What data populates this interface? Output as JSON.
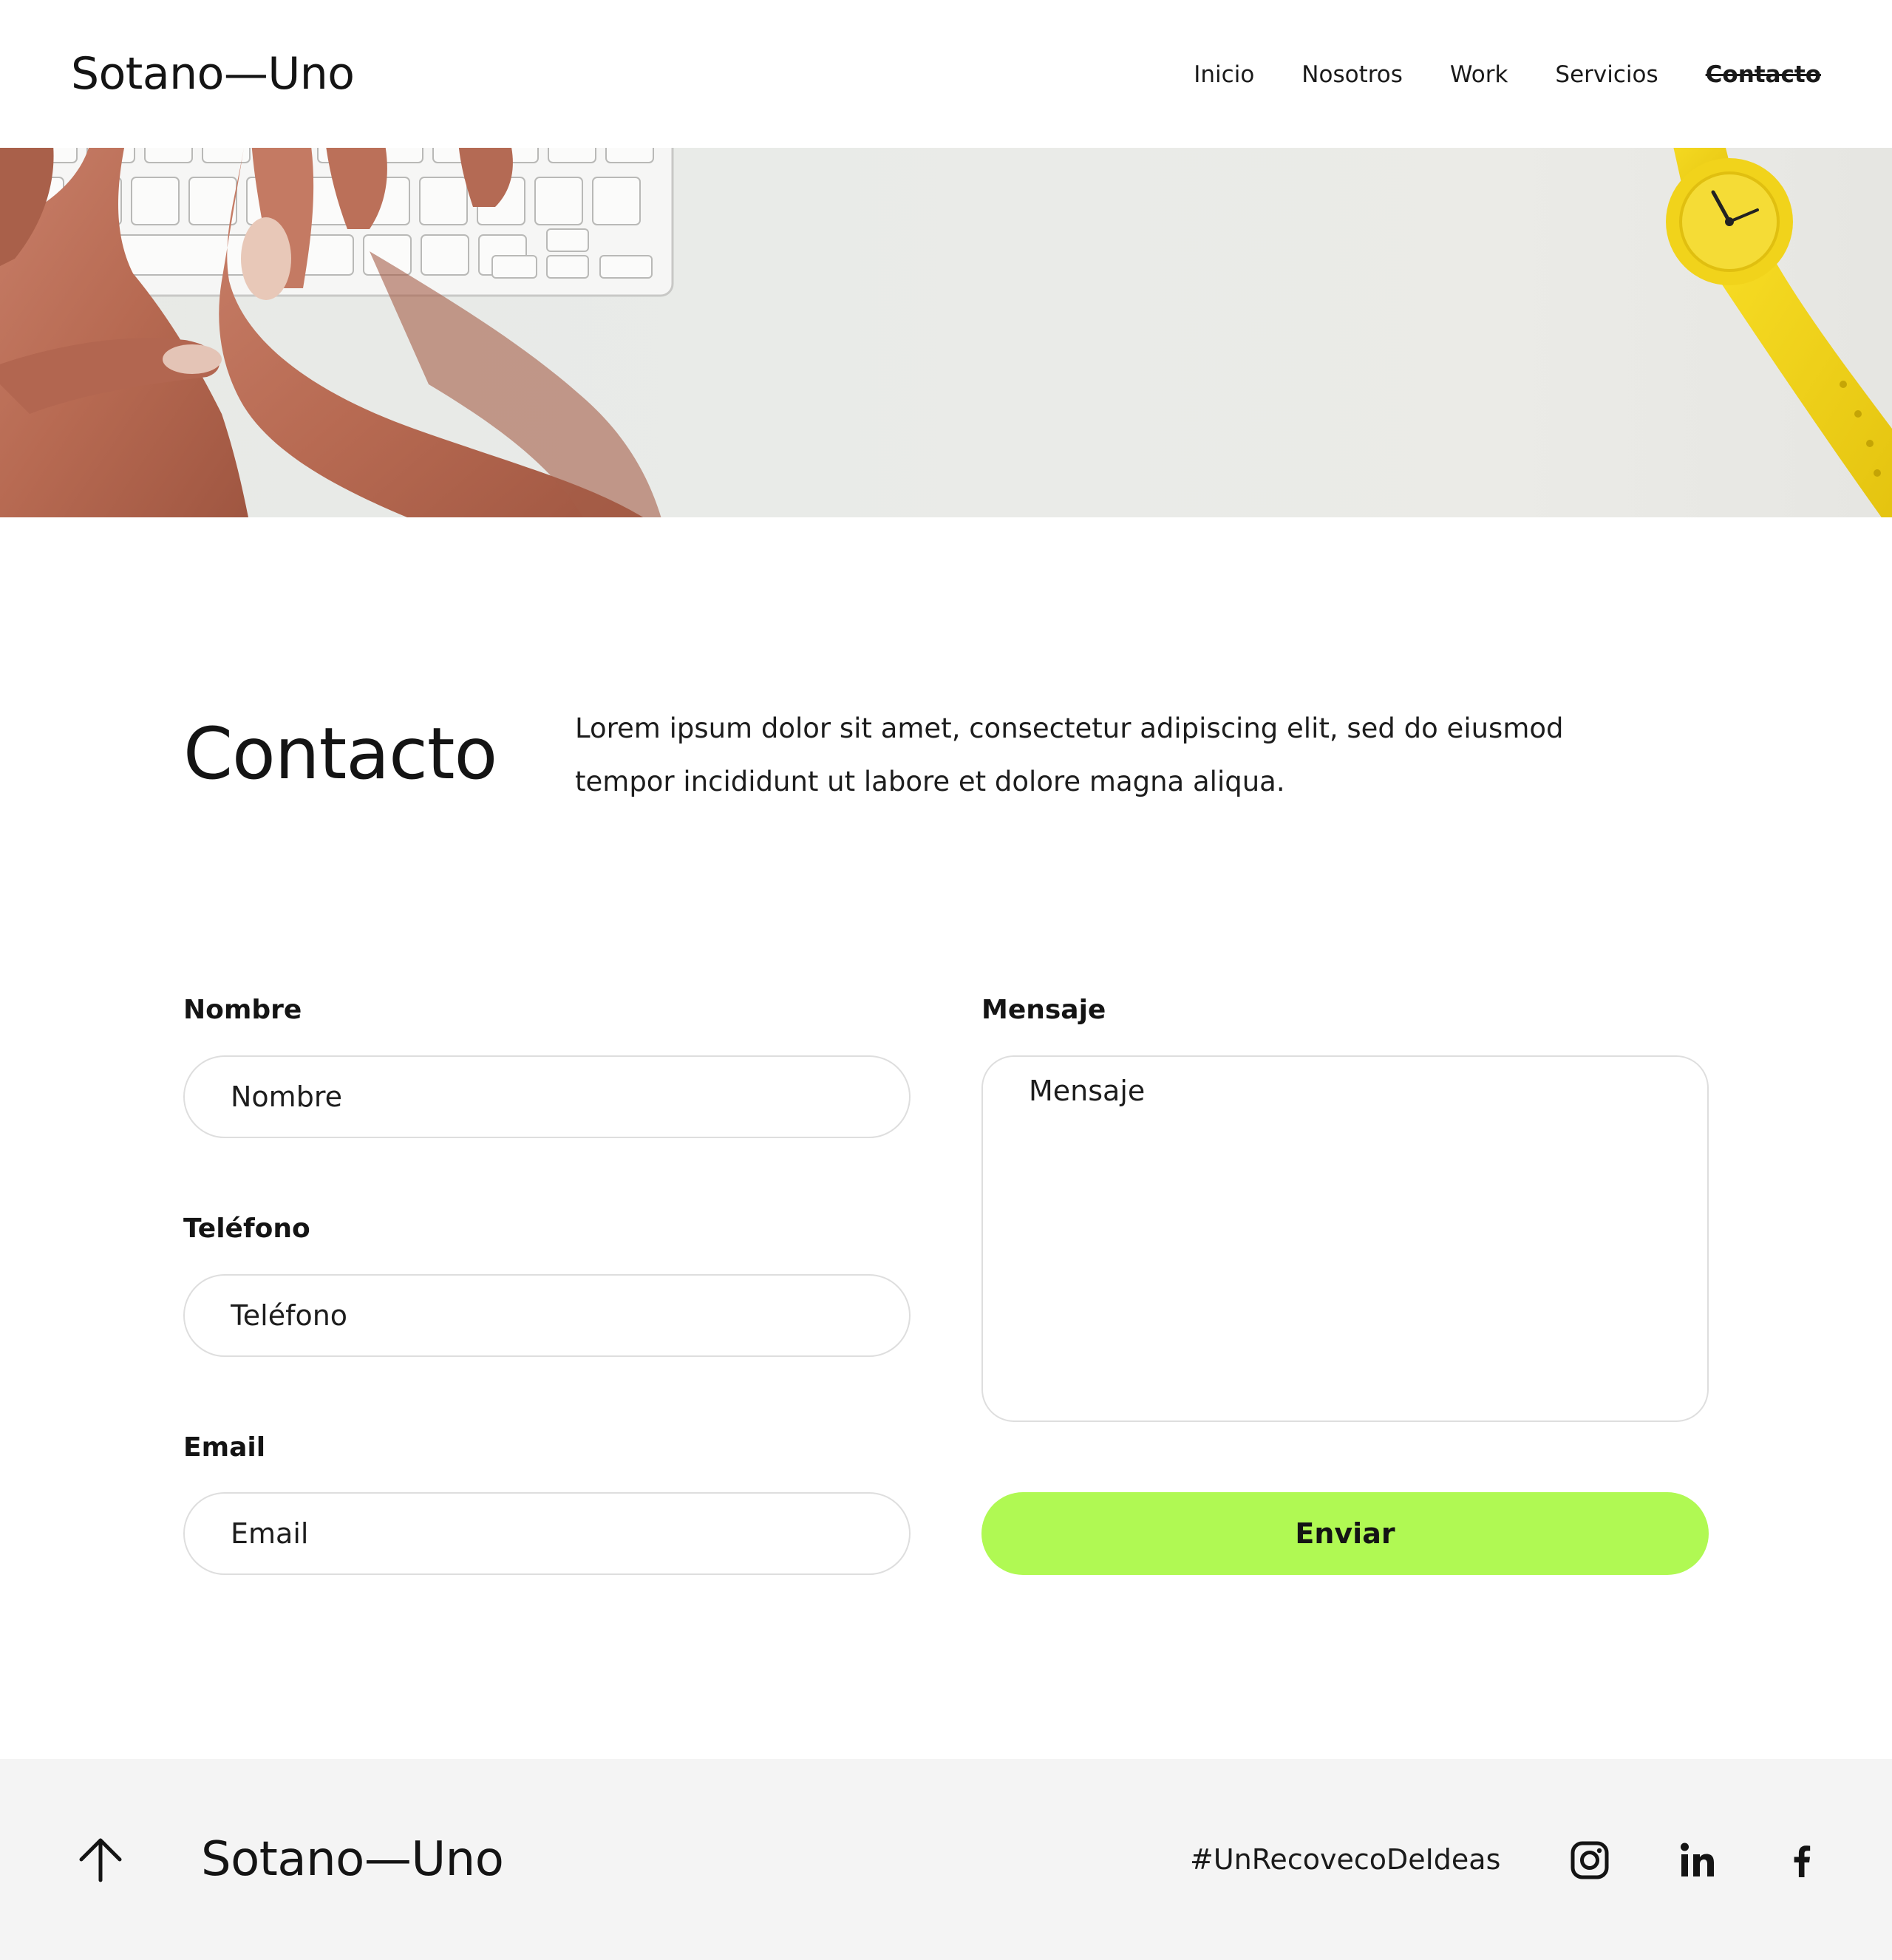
{
  "brand": {
    "name": "Sotano—Uno"
  },
  "nav": {
    "items": [
      {
        "label": "Inicio",
        "active": false
      },
      {
        "label": "Nosotros",
        "active": false
      },
      {
        "label": "Work",
        "active": false
      },
      {
        "label": "Servicios",
        "active": false
      },
      {
        "label": "Contacto",
        "active": true
      }
    ]
  },
  "hero": {
    "image": "hands-typing-keyboard-yellow-watch"
  },
  "contact": {
    "title": "Contacto",
    "intro": "Lorem ipsum dolor sit amet, consectetur adipiscing elit, sed do eiusmod tempor incididunt ut labore et dolore magna aliqua."
  },
  "form": {
    "name": {
      "label": "Nombre",
      "placeholder": "Nombre"
    },
    "phone": {
      "label": "Teléfono",
      "placeholder": "Teléfono"
    },
    "email": {
      "label": "Email",
      "placeholder": "Email"
    },
    "message": {
      "label": "Mensaje",
      "placeholder": "Mensaje"
    },
    "submit_label": "Enviar"
  },
  "footer": {
    "brand": "Sotano—Uno",
    "hashtag": "#UnRecovecoDeIdeas",
    "social": [
      "instagram-icon",
      "linkedin-icon",
      "facebook-icon"
    ]
  },
  "colors": {
    "accent": "#b0f953",
    "text": "#141414",
    "footer_bg": "#f4f4f4",
    "field_border": "#dedede"
  }
}
